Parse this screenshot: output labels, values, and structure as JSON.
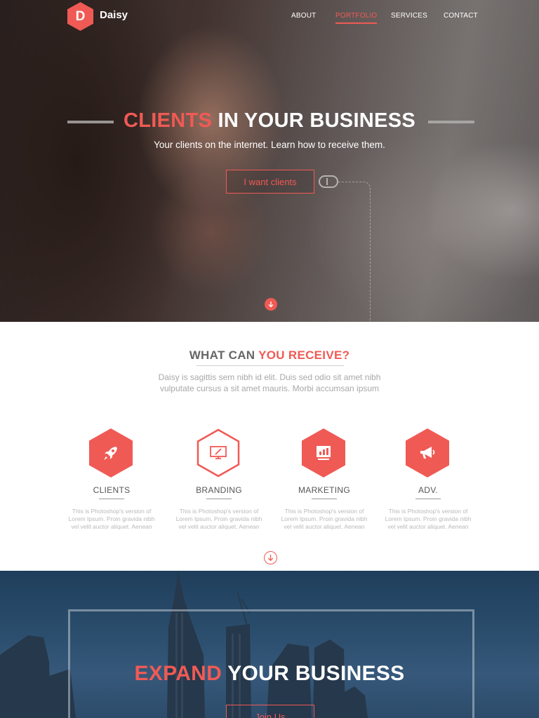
{
  "brand": {
    "logo_letter": "D",
    "name": "Daisy",
    "accent_color": "#f05a55"
  },
  "nav": {
    "items": [
      {
        "label": "ABOUT",
        "active": false
      },
      {
        "label": "PORTFOLIO",
        "active": true
      },
      {
        "label": "SERVICES",
        "active": false
      },
      {
        "label": "CONTACT",
        "active": false
      }
    ]
  },
  "hero": {
    "title_accent": "CLIENTS",
    "title_rest": " IN YOUR BUSINESS",
    "subtitle": "Your clients on the internet. Learn how to receive them.",
    "button_label": "I want clients"
  },
  "features": {
    "title_plain": "WHAT CAN ",
    "title_accent": "YOU RECEIVE?",
    "description": "Daisy is sagittis sem nibh id elit. Duis sed odio sit amet nibh vulputate cursus a sit amet mauris. Morbi accumsan ipsum",
    "items": [
      {
        "title": "CLIENTS",
        "icon": "rocket-icon",
        "text": "This is Photoshop's version  of Lorem Ipsum. Proin gravida nibh vel velit auctor aliquet. Aenean"
      },
      {
        "title": "BRANDING",
        "icon": "monitor-pen-icon",
        "text": "This is Photoshop's version  of Lorem Ipsum. Proin gravida nibh vel velit auctor aliquet. Aenean"
      },
      {
        "title": "MARKETING",
        "icon": "chart-screen-icon",
        "text": "This is Photoshop's version  of Lorem Ipsum. Proin gravida nibh vel velit auctor aliquet. Aenean"
      },
      {
        "title": "ADV.",
        "icon": "megaphone-icon",
        "text": "This is Photoshop's version  of Lorem Ipsum. Proin gravida nibh vel velit auctor aliquet. Aenean"
      }
    ]
  },
  "expand": {
    "title_accent": "EXPAND",
    "title_rest": " YOUR BUSINESS",
    "button_label": "Join Us"
  }
}
